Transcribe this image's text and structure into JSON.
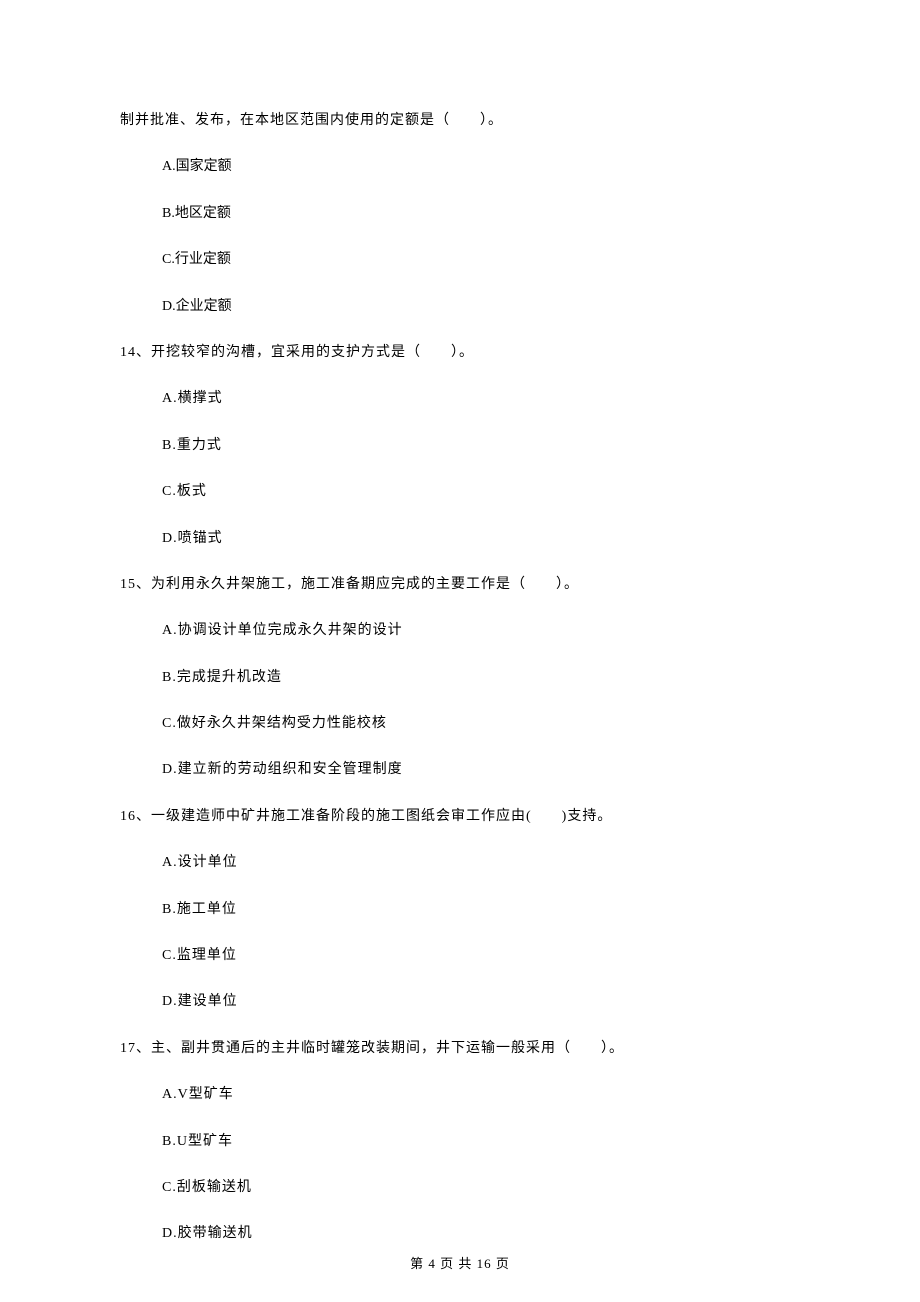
{
  "continuation_text": "制并批准、发布，在本地区范围内使用的定额是（　　）。",
  "q13_options": {
    "a": "A.国家定额",
    "b": "B.地区定额",
    "c": "C.行业定额",
    "d": "D.企业定额"
  },
  "q14": {
    "text": "14、开挖较窄的沟槽，宜采用的支护方式是（　　）。",
    "options": {
      "a": "A.横撑式",
      "b": "B.重力式",
      "c": "C.板式",
      "d": "D.喷锚式"
    }
  },
  "q15": {
    "text": "15、为利用永久井架施工，施工准备期应完成的主要工作是（　　）。",
    "options": {
      "a": "A.协调设计单位完成永久井架的设计",
      "b": "B.完成提升机改造",
      "c": "C.做好永久井架结构受力性能校核",
      "d": "D.建立新的劳动组织和安全管理制度"
    }
  },
  "q16": {
    "text": "16、一级建造师中矿井施工准备阶段的施工图纸会审工作应由(　　)支持。",
    "options": {
      "a": "A.设计单位",
      "b": "B.施工单位",
      "c": "C.监理单位",
      "d": "D.建设单位"
    }
  },
  "q17": {
    "text": "17、主、副井贯通后的主井临时罐笼改装期间，井下运输一般采用（　　）。",
    "options": {
      "a": "A.V型矿车",
      "b": "B.U型矿车",
      "c": "C.刮板输送机",
      "d": "D.胶带输送机"
    }
  },
  "footer": "第 4 页 共 16 页"
}
